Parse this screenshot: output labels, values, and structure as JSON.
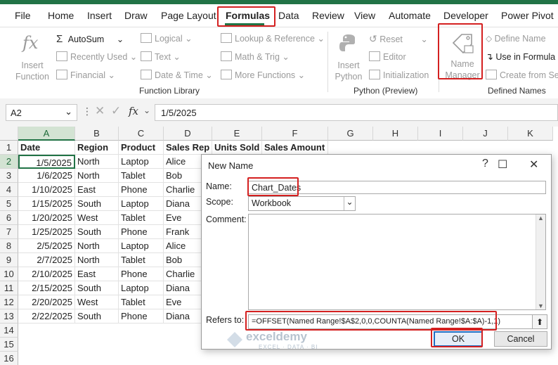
{
  "ribbon": {
    "tabs": [
      "File",
      "Home",
      "Insert",
      "Draw",
      "Page Layout",
      "Formulas",
      "Data",
      "Review",
      "View",
      "Automate",
      "Developer",
      "Power Pivot"
    ],
    "active_tab": "Formulas",
    "function_library": {
      "insert_function": "Insert Function",
      "autosum": "AutoSum",
      "recently_used": "Recently Used",
      "financial": "Financial",
      "logical": "Logical",
      "text": "Text",
      "date_time": "Date & Time",
      "lookup_reference": "Lookup & Reference",
      "math_trig": "Math & Trig",
      "more_functions": "More Functions",
      "group_label": "Function Library"
    },
    "python": {
      "insert_python": "Insert Python",
      "reset": "Reset",
      "editor": "Editor",
      "initialization": "Initialization",
      "group_label": "Python (Preview)"
    },
    "defined_names": {
      "name_manager": "Name Manager",
      "define_name": "Define Name",
      "use_in_formula": "Use in Formula",
      "create_from_selection": "Create from Sele",
      "group_label": "Defined Names"
    }
  },
  "formula_bar": {
    "name_box": "A2",
    "fx": "fx",
    "value": "1/5/2025"
  },
  "sheet": {
    "columns": [
      "A",
      "B",
      "C",
      "D",
      "E",
      "F",
      "G",
      "H",
      "I",
      "J",
      "K"
    ],
    "rows": [
      "1",
      "2",
      "3",
      "4",
      "5",
      "6",
      "7",
      "8",
      "9",
      "10",
      "11",
      "12",
      "13",
      "14",
      "15",
      "16"
    ],
    "headers": [
      "Date",
      "Region",
      "Product",
      "Sales Rep",
      "Units Sold",
      "Sales Amount"
    ],
    "data": [
      [
        "1/5/2025",
        "North",
        "Laptop",
        "Alice"
      ],
      [
        "1/6/2025",
        "North",
        "Tablet",
        "Bob"
      ],
      [
        "1/10/2025",
        "East",
        "Phone",
        "Charlie"
      ],
      [
        "1/15/2025",
        "South",
        "Laptop",
        "Diana"
      ],
      [
        "1/20/2025",
        "West",
        "Tablet",
        "Eve"
      ],
      [
        "1/25/2025",
        "South",
        "Phone",
        "Frank"
      ],
      [
        "2/5/2025",
        "North",
        "Laptop",
        "Alice"
      ],
      [
        "2/7/2025",
        "North",
        "Tablet",
        "Bob"
      ],
      [
        "2/10/2025",
        "East",
        "Phone",
        "Charlie"
      ],
      [
        "2/15/2025",
        "South",
        "Laptop",
        "Diana"
      ],
      [
        "2/20/2025",
        "West",
        "Tablet",
        "Eve"
      ],
      [
        "2/22/2025",
        "South",
        "Phone",
        "Diana"
      ]
    ]
  },
  "dialog": {
    "title": "New Name",
    "name_label": "Name:",
    "name_value": "Chart_Dates",
    "scope_label": "Scope:",
    "scope_value": "Workbook",
    "comment_label": "Comment:",
    "refers_label": "Refers to:",
    "refers_value": "=OFFSET(Named Range!$A$2,0,0,COUNTA(Named Range!$A:$A)-1,1)",
    "ok": "OK",
    "cancel": "Cancel"
  },
  "watermark": {
    "brand": "exceldemy",
    "tagline": "EXCEL · DATA · BI"
  },
  "colors": {
    "excel_green": "#217346",
    "highlight_red": "#d42020",
    "dialog_focus_blue": "#1f6fc4"
  }
}
